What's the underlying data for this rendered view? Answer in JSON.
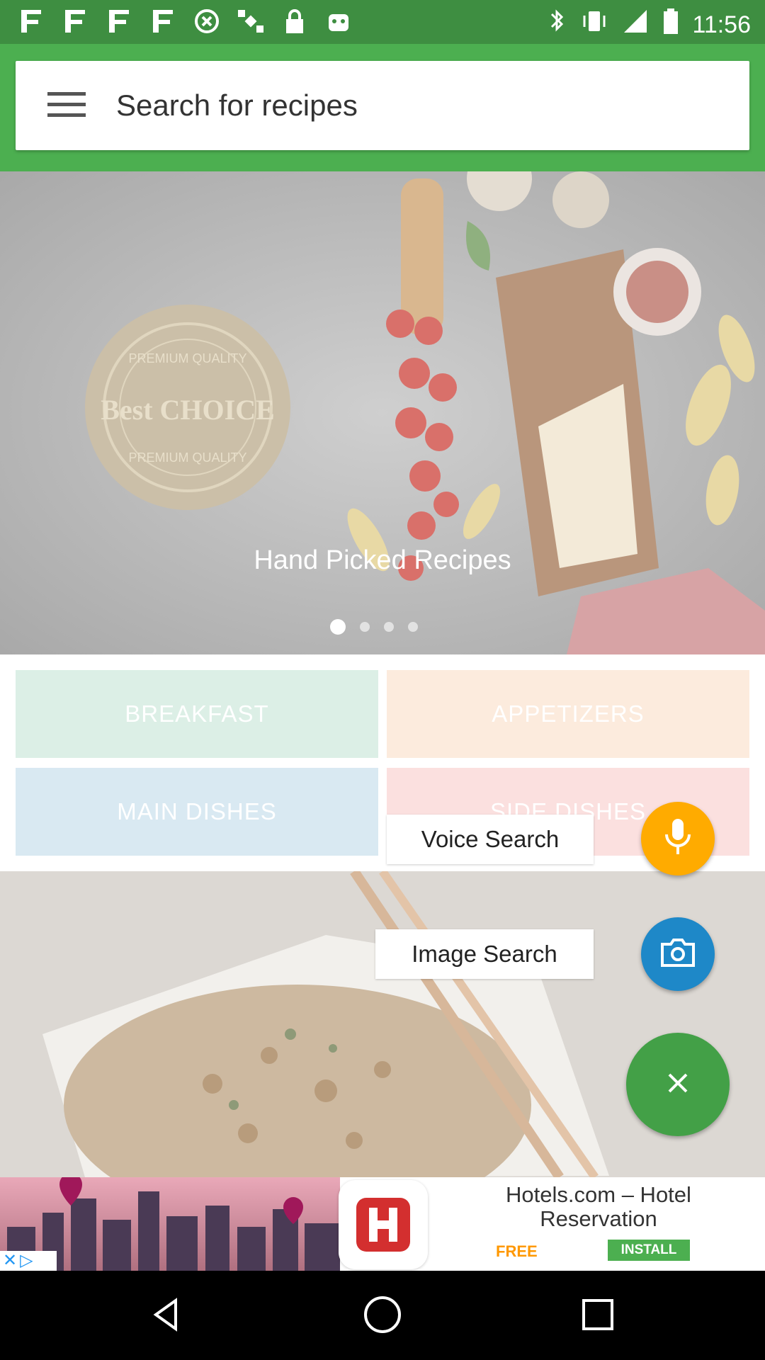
{
  "status_bar": {
    "time": "11:56",
    "left_icons": [
      "ff-icon",
      "ff-icon",
      "ff-icon",
      "ff-icon",
      "alarm-icon",
      "satellite-icon",
      "lock-icon",
      "android-icon"
    ],
    "right_icons": [
      "bluetooth-icon",
      "vibrate-icon",
      "signal-icon",
      "battery-icon"
    ]
  },
  "search": {
    "placeholder": "Search for recipes"
  },
  "banner": {
    "title": "Hand Picked Recipes",
    "slide_count": 4,
    "active_slide": 1,
    "badge_text_top": "PREMIUM QUALITY",
    "badge_text_main": "Best CHOICE",
    "badge_text_bottom": "PREMIUM QUALITY"
  },
  "categories": [
    {
      "label": "BREAKFAST",
      "color": "#dcefe6"
    },
    {
      "label": "APPETIZERS",
      "color": "#fcebdd"
    },
    {
      "label": "MAIN DISHES",
      "color": "#d9e9f2"
    },
    {
      "label": "SIDE DISHES",
      "color": "#fbe0df"
    }
  ],
  "fab_menu": {
    "voice_label": "Voice Search",
    "image_label": "Image Search",
    "voice_color": "#ffab00",
    "image_color": "#1e88c8",
    "close_color": "#43a047"
  },
  "ad": {
    "title": "Hotels.com – Hotel Reservation",
    "price": "FREE",
    "cta": "INSTALL"
  },
  "colors": {
    "primary": "#4caf50",
    "status_bar": "#3e8e41"
  }
}
